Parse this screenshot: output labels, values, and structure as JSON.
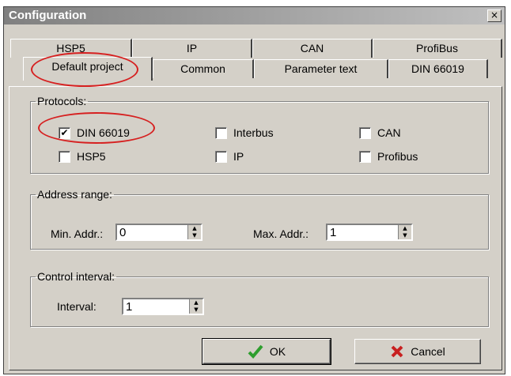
{
  "window": {
    "title": "Configuration",
    "close_glyph": "×"
  },
  "tabs_back": [
    "HSP5",
    "IP",
    "CAN",
    "ProfiBus"
  ],
  "tabs_front": [
    "Default project",
    "Common",
    "Parameter text",
    "DIN 66019"
  ],
  "protocols": {
    "legend": "Protocols:",
    "items": [
      {
        "label": "DIN 66019",
        "checked": true
      },
      {
        "label": "Interbus",
        "checked": false
      },
      {
        "label": "CAN",
        "checked": false
      },
      {
        "label": "HSP5",
        "checked": false
      },
      {
        "label": "IP",
        "checked": false
      },
      {
        "label": "Profibus",
        "checked": false
      }
    ]
  },
  "address": {
    "legend": "Address range:",
    "min_label": "Min. Addr.:",
    "min_value": "0",
    "max_label": "Max. Addr.:",
    "max_value": "1"
  },
  "control": {
    "legend": "Control interval:",
    "interval_label": "Interval:",
    "interval_value": "1"
  },
  "buttons": {
    "ok": "OK",
    "cancel": "Cancel"
  },
  "colors": {
    "annotation": "#d62020",
    "ok_check": "#2e9e2e",
    "cancel_x": "#c82020"
  },
  "icons": {
    "ok": "checkmark-icon",
    "cancel": "x-icon",
    "spinner": "spinner-arrows-icon"
  }
}
